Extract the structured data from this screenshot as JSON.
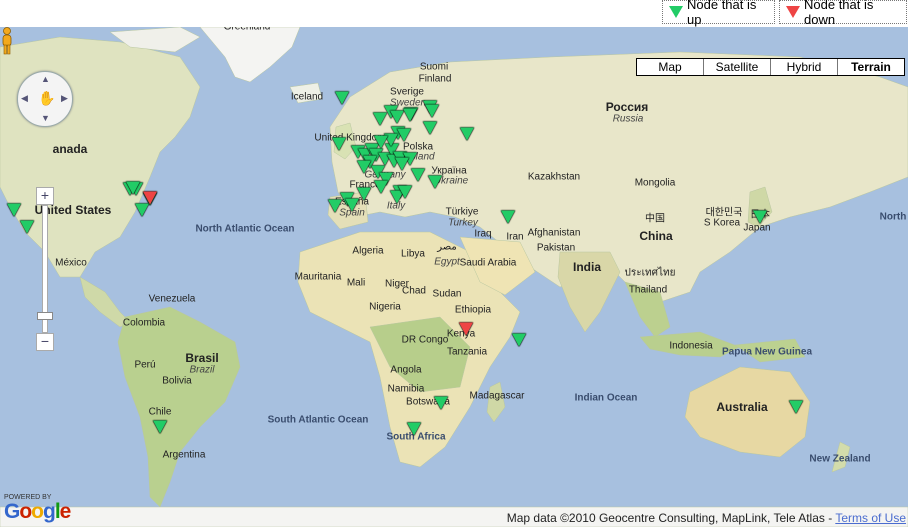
{
  "legend": {
    "up_label": "Node that is up",
    "down_label": "Node that is down",
    "up_color": "#22cc66",
    "down_color": "#ee4444"
  },
  "map_types": [
    "Map",
    "Satellite",
    "Hybrid",
    "Terrain"
  ],
  "active_map_type": "Terrain",
  "controls": {
    "zoom_in": "+",
    "zoom_out": "−"
  },
  "attribution": {
    "text": "Map data ©2010 Geocentre Consulting, MapLink, Tele Atlas - ",
    "terms": "Terms of Use"
  },
  "branding": {
    "powered": "POWERED BY",
    "logo": "Google"
  },
  "labels": [
    {
      "id": "greenland",
      "text": "Greenland"
    },
    {
      "id": "iceland",
      "text": "Iceland"
    },
    {
      "id": "sverige",
      "text": "Sverige"
    },
    {
      "id": "sweden",
      "text": "Sweden"
    },
    {
      "id": "suomi",
      "text": "Suomi"
    },
    {
      "id": "finland",
      "text": "Finland"
    },
    {
      "id": "rossiya",
      "text": "Россия"
    },
    {
      "id": "russia",
      "text": "Russia"
    },
    {
      "id": "canada",
      "text": "anada"
    },
    {
      "id": "united-states",
      "text": "United States"
    },
    {
      "id": "mexico",
      "text": "México"
    },
    {
      "id": "north-atlantic",
      "text": "North Atlantic Ocean"
    },
    {
      "id": "united-kingdom",
      "text": "United Kingdom"
    },
    {
      "id": "polska",
      "text": "Polska"
    },
    {
      "id": "poland",
      "text": "Poland"
    },
    {
      "id": "ukraina",
      "text": "Україна"
    },
    {
      "id": "ukraine",
      "text": "Ukraine"
    },
    {
      "id": "germany",
      "text": "Germany"
    },
    {
      "id": "france",
      "text": "France"
    },
    {
      "id": "espana",
      "text": "España"
    },
    {
      "id": "spain",
      "text": "Spain"
    },
    {
      "id": "italy",
      "text": "Italy"
    },
    {
      "id": "turkiye",
      "text": "Türkiye"
    },
    {
      "id": "turkey",
      "text": "Turkey"
    },
    {
      "id": "kazakhstan",
      "text": "Kazakhstan"
    },
    {
      "id": "mongolia",
      "text": "Mongolia"
    },
    {
      "id": "iraq",
      "text": "Iraq"
    },
    {
      "id": "iran",
      "text": "Iran"
    },
    {
      "id": "afghanistan",
      "text": "Afghanistan"
    },
    {
      "id": "pakistan",
      "text": "Pakistan"
    },
    {
      "id": "china-zh",
      "text": "中国"
    },
    {
      "id": "china",
      "text": "China"
    },
    {
      "id": "korea-ko",
      "text": "대한민국"
    },
    {
      "id": "korea",
      "text": "S Korea"
    },
    {
      "id": "japan-ja",
      "text": "日本"
    },
    {
      "id": "japan",
      "text": "Japan"
    },
    {
      "id": "north-pacific",
      "text": "North"
    },
    {
      "id": "algeria",
      "text": "Algeria"
    },
    {
      "id": "libya",
      "text": "Libya"
    },
    {
      "id": "misr",
      "text": "مصر"
    },
    {
      "id": "egypt",
      "text": "Egypt"
    },
    {
      "id": "saudi",
      "text": "Saudi Arabia"
    },
    {
      "id": "india",
      "text": "India"
    },
    {
      "id": "thailand-th",
      "text": "ประเทศไทย"
    },
    {
      "id": "thailand",
      "text": "Thailand"
    },
    {
      "id": "mauritania",
      "text": "Mauritania"
    },
    {
      "id": "mali",
      "text": "Mali"
    },
    {
      "id": "niger",
      "text": "Niger"
    },
    {
      "id": "chad",
      "text": "Chad"
    },
    {
      "id": "sudan",
      "text": "Sudan"
    },
    {
      "id": "ethiopia",
      "text": "Ethiopia"
    },
    {
      "id": "nigeria",
      "text": "Nigeria"
    },
    {
      "id": "kenya",
      "text": "Kenya"
    },
    {
      "id": "drcongo",
      "text": "DR Congo"
    },
    {
      "id": "tanzania",
      "text": "Tanzania"
    },
    {
      "id": "angola",
      "text": "Angola"
    },
    {
      "id": "namibia",
      "text": "Namibia"
    },
    {
      "id": "botswana",
      "text": "Botswana"
    },
    {
      "id": "madagascar",
      "text": "Madagascar"
    },
    {
      "id": "south-africa",
      "text": "South Africa"
    },
    {
      "id": "venezuela",
      "text": "Venezuela"
    },
    {
      "id": "colombia",
      "text": "Colombia"
    },
    {
      "id": "brasil",
      "text": "Brasil"
    },
    {
      "id": "brazil",
      "text": "Brazil"
    },
    {
      "id": "peru",
      "text": "Perú"
    },
    {
      "id": "bolivia",
      "text": "Bolivia"
    },
    {
      "id": "chile",
      "text": "Chile"
    },
    {
      "id": "argentina",
      "text": "Argentina"
    },
    {
      "id": "south-atlantic",
      "text": "South Atlantic Ocean"
    },
    {
      "id": "indian-ocean",
      "text": "Indian Ocean"
    },
    {
      "id": "indonesia",
      "text": "Indonesia"
    },
    {
      "id": "png",
      "text": "Papua New Guinea"
    },
    {
      "id": "australia",
      "text": "Australia"
    },
    {
      "id": "new-zealand",
      "text": "New Zealand"
    }
  ],
  "markers": [
    {
      "status": "up"
    },
    {
      "status": "up"
    },
    {
      "status": "up"
    },
    {
      "status": "up"
    },
    {
      "status": "up"
    },
    {
      "status": "up"
    },
    {
      "status": "up"
    },
    {
      "status": "down"
    },
    {
      "status": "up"
    },
    {
      "status": "up"
    },
    {
      "status": "up"
    },
    {
      "status": "up"
    },
    {
      "status": "up"
    },
    {
      "status": "up"
    },
    {
      "status": "up"
    },
    {
      "status": "up"
    },
    {
      "status": "up"
    },
    {
      "status": "up"
    },
    {
      "status": "up"
    },
    {
      "status": "up"
    },
    {
      "status": "up"
    },
    {
      "status": "up"
    },
    {
      "status": "up"
    },
    {
      "status": "up"
    },
    {
      "status": "up"
    },
    {
      "status": "up"
    },
    {
      "status": "up"
    },
    {
      "status": "up"
    },
    {
      "status": "up"
    },
    {
      "status": "up"
    },
    {
      "status": "up"
    },
    {
      "status": "up"
    },
    {
      "status": "up"
    },
    {
      "status": "up"
    },
    {
      "status": "up"
    },
    {
      "status": "up"
    },
    {
      "status": "up"
    },
    {
      "status": "up"
    },
    {
      "status": "up"
    },
    {
      "status": "up"
    },
    {
      "status": "up"
    },
    {
      "status": "up"
    },
    {
      "status": "up"
    },
    {
      "status": "up"
    },
    {
      "status": "up"
    },
    {
      "status": "up"
    },
    {
      "status": "up"
    },
    {
      "status": "down"
    },
    {
      "status": "up"
    },
    {
      "status": "up"
    },
    {
      "status": "up"
    },
    {
      "status": "up"
    },
    {
      "status": "up"
    },
    {
      "status": "up"
    },
    {
      "status": "up"
    }
  ]
}
